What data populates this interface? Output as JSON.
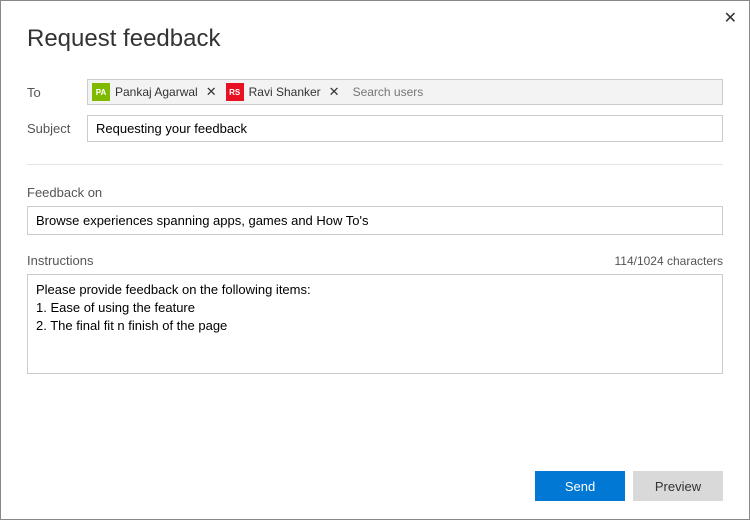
{
  "title": "Request feedback",
  "labels": {
    "to": "To",
    "subject": "Subject",
    "feedback_on": "Feedback on",
    "instructions": "Instructions"
  },
  "to": {
    "recipients": [
      {
        "name": "Pankaj Agarwal",
        "initials": "PA",
        "color": "#7fba00"
      },
      {
        "name": "Ravi Shanker",
        "initials": "RS",
        "color": "#e81123"
      }
    ],
    "search_placeholder": "Search users"
  },
  "subject": {
    "value": "Requesting your feedback"
  },
  "feedback_on": {
    "value": "Browse experiences spanning apps, games and How To's"
  },
  "instructions": {
    "value": "Please provide feedback on the following items:\n1. Ease of using the feature\n2. The final fit n finish of the page",
    "count_text": "114/1024 characters"
  },
  "buttons": {
    "send": "Send",
    "preview": "Preview"
  }
}
